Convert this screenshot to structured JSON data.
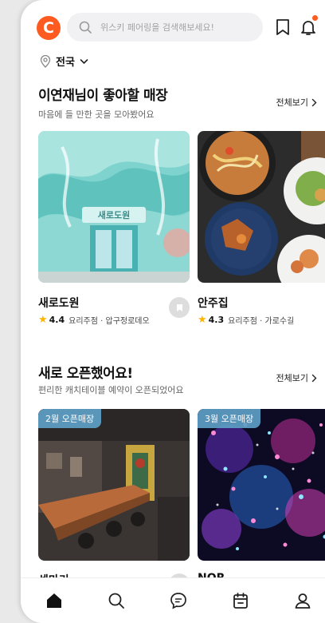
{
  "header": {
    "logo_letter": "C",
    "search_placeholder": "위스키 페어링을 검색해보세요!",
    "accent": "#ff5a1f"
  },
  "location": {
    "label": "전국"
  },
  "sections": [
    {
      "title": "이연재님이 좋아할 매장",
      "subtitle": "마음에 들 만한 곳을 모아봤어요",
      "see_all": "전체보기",
      "cards": [
        {
          "name": "새로도원",
          "rating": "4.4",
          "meta": "요리주점 · 압구정로데오",
          "sign_text": "새로도원"
        },
        {
          "name": "안주집",
          "rating": "4.3",
          "meta": "요리주점 · 가로수길"
        }
      ]
    },
    {
      "title": "새로 오픈했어요!",
      "subtitle": "편리한 캐치테이블 예약이 오픈되었어요",
      "see_all": "전체보기",
      "cards": [
        {
          "name": "센마키",
          "badge": "2월 오픈매장"
        },
        {
          "name": "NOR",
          "badge": "3월 오픈매장"
        }
      ]
    }
  ],
  "bottom_nav": [
    {
      "icon": "home-icon",
      "active": true
    },
    {
      "icon": "search-icon"
    },
    {
      "icon": "chat-icon"
    },
    {
      "icon": "calendar-icon"
    },
    {
      "icon": "profile-icon"
    }
  ]
}
